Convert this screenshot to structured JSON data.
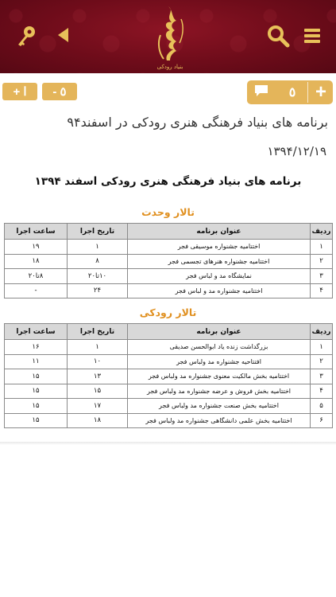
{
  "header": {
    "logo_text": "بنیاد رودکی",
    "icons": [
      "key-icon",
      "back-arrow-icon",
      "search-icon",
      "menu-icon"
    ],
    "colors": {
      "background": "#6e0c1a",
      "gold": "#e8c15a"
    }
  },
  "toolbar": {
    "font_increase_label": "+ ا",
    "font_decrease_label": "- ٥",
    "comment_count": "٥",
    "add_comment_label": "+",
    "button_color": "#e4b55a"
  },
  "article": {
    "title": "برنامه های بنیاد فرهنگی هنری رودکی در اسفند۹۴",
    "date": "۱۳۹۴/۱۲/۱۹"
  },
  "document": {
    "heading": "برنامه های بنیاد فرهنگی هنری رودکی  اسفند ۱۳۹۴",
    "columns": {
      "row": "ردیف",
      "title": "عنوان برنامه",
      "date": "تاریخ اجرا",
      "time": "ساعت اجرا"
    },
    "sections": [
      {
        "name": "تالار وحدت",
        "rows": [
          {
            "row": "۱",
            "title": "اختتامیه جشنواره موسیقی فجر",
            "date": "۱",
            "time": "۱۹"
          },
          {
            "row": "۲",
            "title": "اختتامیه جشنواره هنرهای تجسمی فجر",
            "date": "۸",
            "time": "۱۸"
          },
          {
            "row": "۳",
            "title": "نمایشگاه مد و لباس فجر",
            "date": "۱۰تا۲۰",
            "time": "۸تا۲۰"
          },
          {
            "row": "۴",
            "title": "اختتامیه جشنواره مد و لباس فجر",
            "date": "۲۴",
            "time": "-"
          }
        ]
      },
      {
        "name": "تالار رودکی",
        "rows": [
          {
            "row": "۱",
            "title": "بزرگداشت زنده یاد ابوالحسن صدیقی",
            "date": "۱",
            "time": "۱۶"
          },
          {
            "row": "۲",
            "title": "افتتاحیه جشنواره مد ولباس فجر",
            "date": "۱۰",
            "time": "۱۱"
          },
          {
            "row": "۳",
            "title": "اختتامیه بخش مالکیت معنوی جشنواره مد ولباس فجر",
            "date": "۱۳",
            "time": "۱۵"
          },
          {
            "row": "۴",
            "title": "اختتامیه بخش فروش و عرضه جشنواره مد ولباس فجر",
            "date": "۱۵",
            "time": "۱۵"
          },
          {
            "row": "۵",
            "title": "اختتامیه بخش صنعت جشنواره مد ولباس فجر",
            "date": "۱۷",
            "time": "۱۵"
          },
          {
            "row": "۶",
            "title": "اختتامیه بخش علمی دانشگاهی جشنواره مد ولباس فجر",
            "date": "۱۸",
            "time": "۱۵"
          }
        ]
      }
    ]
  }
}
